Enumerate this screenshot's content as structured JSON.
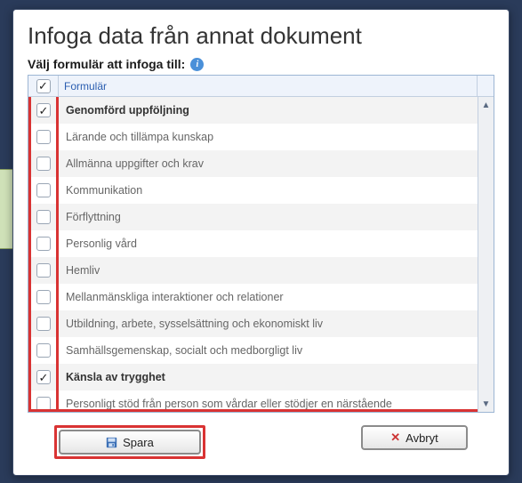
{
  "title": "Infoga data från annat dokument",
  "subtitle": "Välj formulär att infoga till:",
  "help_tooltip": "i",
  "grid": {
    "header_col": "Formulär",
    "select_all_checked": true,
    "rows": [
      {
        "label": "Genomförd uppföljning",
        "checked": true
      },
      {
        "label": "Lärande och tillämpa kunskap",
        "checked": false
      },
      {
        "label": "Allmänna uppgifter och krav",
        "checked": false
      },
      {
        "label": "Kommunikation",
        "checked": false
      },
      {
        "label": "Förflyttning",
        "checked": false
      },
      {
        "label": "Personlig vård",
        "checked": false
      },
      {
        "label": "Hemliv",
        "checked": false
      },
      {
        "label": "Mellanmänskliga interaktioner och relationer",
        "checked": false
      },
      {
        "label": "Utbildning, arbete, sysselsättning och ekonomiskt liv",
        "checked": false
      },
      {
        "label": "Samhällsgemenskap, socialt och medborgligt liv",
        "checked": false
      },
      {
        "label": "Känsla av trygghet",
        "checked": true
      },
      {
        "label": "Personligt stöd från person som vårdar eller stödjer en närstående",
        "checked": false
      }
    ]
  },
  "footer": {
    "save_label": "Spara",
    "cancel_label": "Avbryt"
  }
}
